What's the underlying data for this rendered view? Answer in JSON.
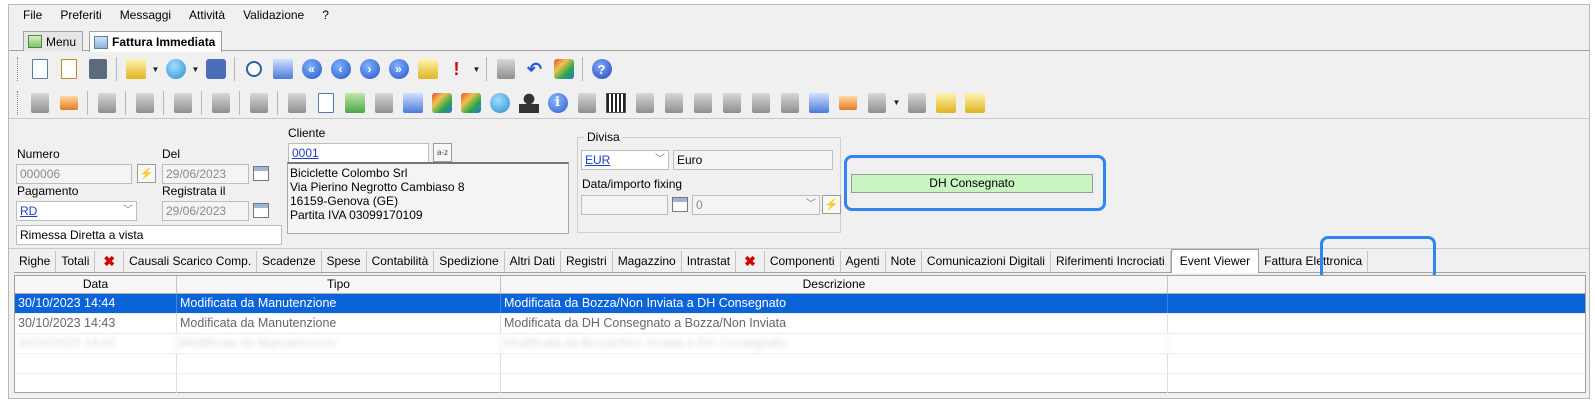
{
  "menubar": [
    "File",
    "Preferiti",
    "Messaggi",
    "Attività",
    "Validazione",
    "?"
  ],
  "doc_tabs": [
    {
      "label": "Menu",
      "active": false
    },
    {
      "label": "Fattura Immediata",
      "active": true
    }
  ],
  "toolbar1_icons": [
    "new-doc-icon",
    "edit-doc-icon",
    "save-icon",
    "import-icon",
    "globe-icon",
    "settings-icon",
    "search-icon",
    "tag-icon",
    "first-icon",
    "prev-icon",
    "next-icon",
    "last-icon",
    "attach-icon",
    "alert-icon",
    "send-icon",
    "undo-icon",
    "archive-icon",
    "help-icon"
  ],
  "toolbar2_icons": [
    "mail-grey-icon",
    "mail-open-icon",
    "doc-print1-icon",
    "doc-print2-icon",
    "doc-print3-icon",
    "doc-print4-icon",
    "doc-print5-icon",
    "doc-print6-icon",
    "copy-icon",
    "tree-icon",
    "list-icon",
    "clipboard-icon",
    "color-globe1-icon",
    "color-globe2-icon",
    "compass-icon",
    "person-icon",
    "info-icon",
    "scanner-icon",
    "barcode-icon",
    "users-icon",
    "export1-icon",
    "export2-icon",
    "transfer-icon",
    "tools-icon",
    "tag-doc-icon",
    "chain-icon",
    "vendor-icon",
    "flag-icon",
    "stack-icon",
    "calendar-icon",
    "email-icon"
  ],
  "form": {
    "numero_label": "Numero",
    "numero_value": "000006",
    "del_label": "Del",
    "del_value": "29/06/2023",
    "pagamento_label": "Pagamento",
    "pagamento_value": "RD",
    "registrata_label": "Registrata il",
    "registrata_value": "29/06/2023",
    "pagamento_desc": "Rimessa Diretta a vista",
    "cliente_label": "Cliente",
    "cliente_code": "0001",
    "cliente_address": [
      "Biciclette Colombo Srl",
      "Via Pierino Negrotto Cambiaso 8",
      "16159-Genova (GE)",
      "Partita IVA 03099170109"
    ],
    "divisa_label": "Divisa",
    "divisa_code": "EUR",
    "divisa_desc": "Euro",
    "fixing_label": "Data/importo fixing",
    "fixing_value": "0",
    "status": "DH Consegnato"
  },
  "tabs": [
    {
      "label": "Righe"
    },
    {
      "label": "Totali"
    },
    {
      "label": "✖",
      "type": "x"
    },
    {
      "label": "Causali Scarico Comp."
    },
    {
      "label": "Scadenze"
    },
    {
      "label": "Spese"
    },
    {
      "label": "Contabilità"
    },
    {
      "label": "Spedizione"
    },
    {
      "label": "Altri Dati"
    },
    {
      "label": "Registri"
    },
    {
      "label": "Magazzino"
    },
    {
      "label": "Intrastat"
    },
    {
      "label": "✖",
      "type": "x"
    },
    {
      "label": "Componenti"
    },
    {
      "label": "Agenti"
    },
    {
      "label": "Note"
    },
    {
      "label": "Comunicazioni Digitali"
    },
    {
      "label": "Riferimenti Incrociati"
    },
    {
      "label": "Event Viewer",
      "active": true
    },
    {
      "label": "Fattura Elettronica"
    }
  ],
  "grid": {
    "columns": [
      "Data",
      "Tipo",
      "Descrizione"
    ],
    "rows": [
      {
        "data": "30/10/2023 14:44",
        "tipo": "Modificata da Manutenzione",
        "descrizione": "Modificata da Bozza/Non Inviata a DH Consegnato",
        "state": "sel"
      },
      {
        "data": "30/10/2023 14:43",
        "tipo": "Modificata da Manutenzione",
        "descrizione": "Modificata da DH Consegnato a Bozza/Non Inviata",
        "state": "dim"
      },
      {
        "data": "30/10/2023 14:42",
        "tipo": "Modificata da Manutenzione",
        "descrizione": "Modificata da Bozza/Non Inviata a DH Consegnato",
        "state": "blur"
      }
    ]
  }
}
